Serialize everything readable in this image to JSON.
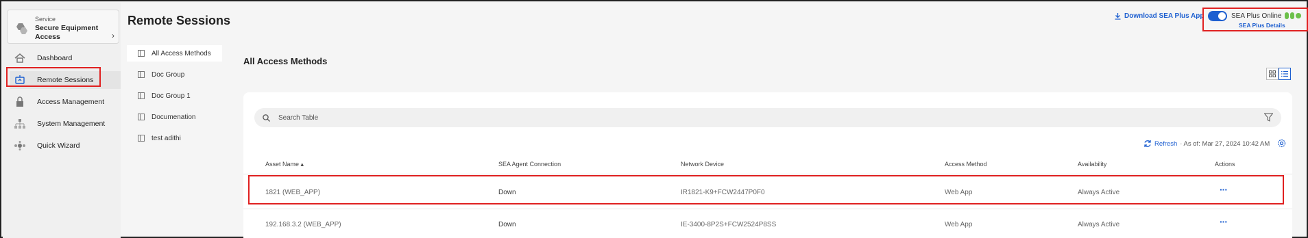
{
  "sidebar": {
    "service_small": "Service",
    "service_name": "Secure Equipment Access",
    "items": [
      {
        "label": "Dashboard",
        "icon": "home-icon"
      },
      {
        "label": "Remote Sessions",
        "icon": "remote-session-icon"
      },
      {
        "label": "Access Management",
        "icon": "lock-icon"
      },
      {
        "label": "System Management",
        "icon": "network-icon"
      },
      {
        "label": "Quick Wizard",
        "icon": "wizard-icon"
      }
    ]
  },
  "header": {
    "title": "Remote Sessions",
    "download_label": "Download SEA Plus App",
    "sea_status": "SEA Plus Online",
    "sea_details": "SEA Plus Details",
    "duo_logo": "DUO"
  },
  "groups": [
    "All Access Methods",
    "Doc Group",
    "Doc Group 1",
    "Documenation",
    "test adithi"
  ],
  "main": {
    "section_title": "All Access Methods",
    "search_placeholder": "Search Table",
    "refresh_label": "Refresh",
    "as_of": "· As of: Mar 27, 2024 10:42 AM"
  },
  "table": {
    "columns": [
      "Asset Name",
      "SEA Agent Connection",
      "Network Device",
      "Access Method",
      "Availability",
      "Actions"
    ],
    "rows": [
      {
        "asset": "1821 (WEB_APP)",
        "connection": "Down",
        "device": "IR1821-K9+FCW2447P0F0",
        "method": "Web App",
        "availability": "Always Active",
        "actions": "···"
      },
      {
        "asset": "192.168.3.2 (WEB_APP)",
        "connection": "Down",
        "device": "IE-3400-8P2S+FCW2524P8SS",
        "method": "Web App",
        "availability": "Always Active",
        "actions": "···"
      }
    ]
  },
  "colors": {
    "accent": "#1d5fd0",
    "highlight": "#e02020",
    "duo": "#6cc04a"
  }
}
